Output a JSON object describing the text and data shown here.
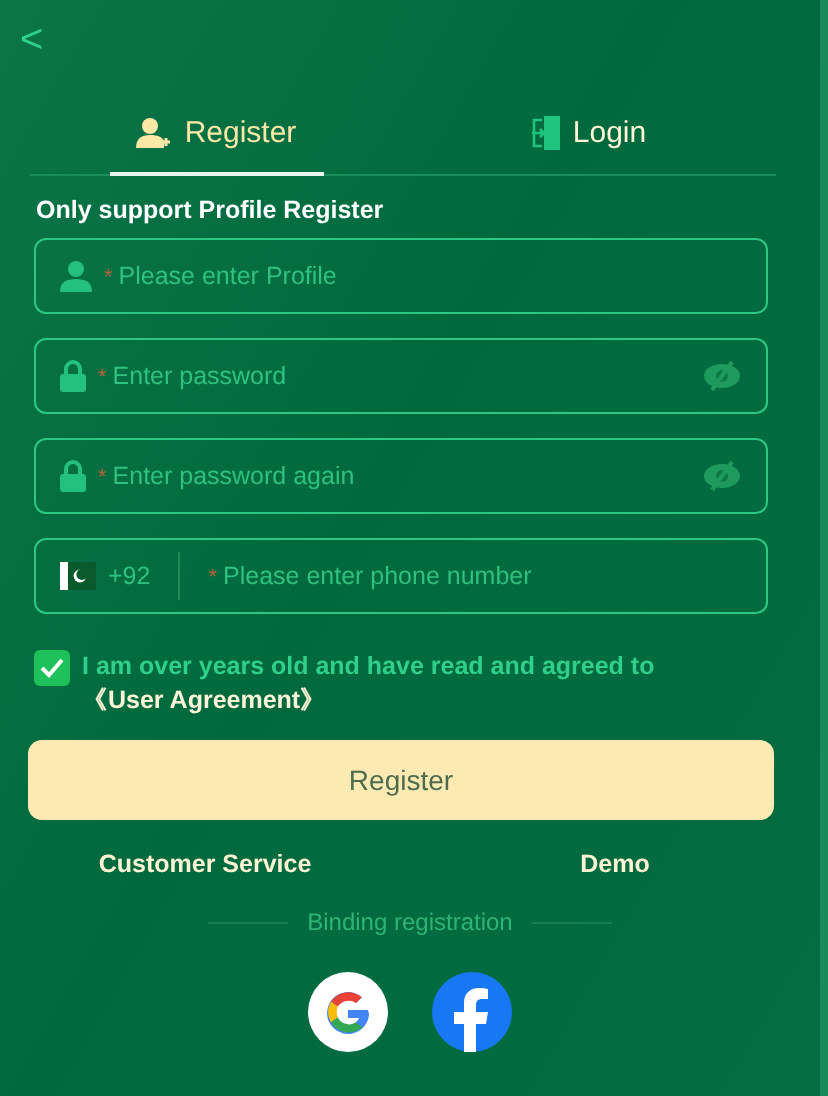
{
  "back": "<",
  "tabs": [
    {
      "label": "Register",
      "kind": "register",
      "selected": true
    },
    {
      "label": "Login",
      "kind": "login",
      "selected": false
    }
  ],
  "note": "Only support Profile Register",
  "fields": [
    {
      "kind": "profile",
      "required": "*",
      "placeholder": "Please enter Profile"
    },
    {
      "kind": "password",
      "required": "*",
      "placeholder": "Enter password"
    },
    {
      "kind": "password",
      "required": "*",
      "placeholder": "Enter password again"
    },
    {
      "kind": "phone",
      "code": "+92",
      "required": "*",
      "placeholder": "Please enter phone number"
    }
  ],
  "agreement": {
    "checked": true,
    "text": "I am over years old and have read and agreed to",
    "link": "《User Agreement》"
  },
  "submit": "Register",
  "links": [
    "Customer Service",
    "Demo"
  ],
  "binding": {
    "title": "Binding registration",
    "providers": [
      {
        "kind": "google"
      },
      {
        "kind": "facebook"
      }
    ]
  }
}
